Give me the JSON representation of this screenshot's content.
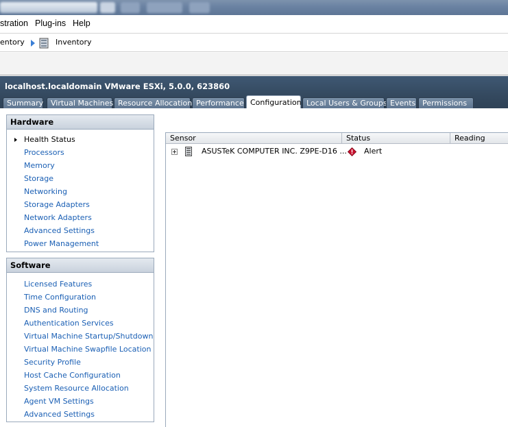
{
  "menubar": {
    "items": [
      "stration",
      "Plug-ins",
      "Help"
    ]
  },
  "navbar": {
    "crumb_prev": "entory",
    "crumb_current": "Inventory"
  },
  "host": {
    "title": "localhost.localdomain VMware ESXi, 5.0.0, 623860"
  },
  "tabs": [
    {
      "label": "Summary"
    },
    {
      "label": "Virtual Machines"
    },
    {
      "label": "Resource Allocation"
    },
    {
      "label": "Performance"
    },
    {
      "label": "Configuration"
    },
    {
      "label": "Local Users & Groups"
    },
    {
      "label": "Events"
    },
    {
      "label": "Permissions"
    }
  ],
  "active_tab": "Configuration",
  "hardware": {
    "title": "Hardware",
    "items": [
      "Health Status",
      "Processors",
      "Memory",
      "Storage",
      "Networking",
      "Storage Adapters",
      "Network Adapters",
      "Advanced Settings",
      "Power Management"
    ]
  },
  "software": {
    "title": "Software",
    "items": [
      "Licensed Features",
      "Time Configuration",
      "DNS and Routing",
      "Authentication Services",
      "Virtual Machine Startup/Shutdown",
      "Virtual Machine Swapfile Location",
      "Security Profile",
      "Host Cache Configuration",
      "System Resource Allocation",
      "Agent VM Settings",
      "Advanced Settings"
    ]
  },
  "sensor_table": {
    "columns": [
      "Sensor",
      "Status",
      "Reading"
    ],
    "rows": [
      {
        "sensor": "ASUSTeK COMPUTER INC. Z9PE-D16 ...",
        "status": "Alert"
      }
    ]
  },
  "colors": {
    "link": "#1a5fb4",
    "header_bg": "#34495f",
    "alert": "#c8102e"
  }
}
